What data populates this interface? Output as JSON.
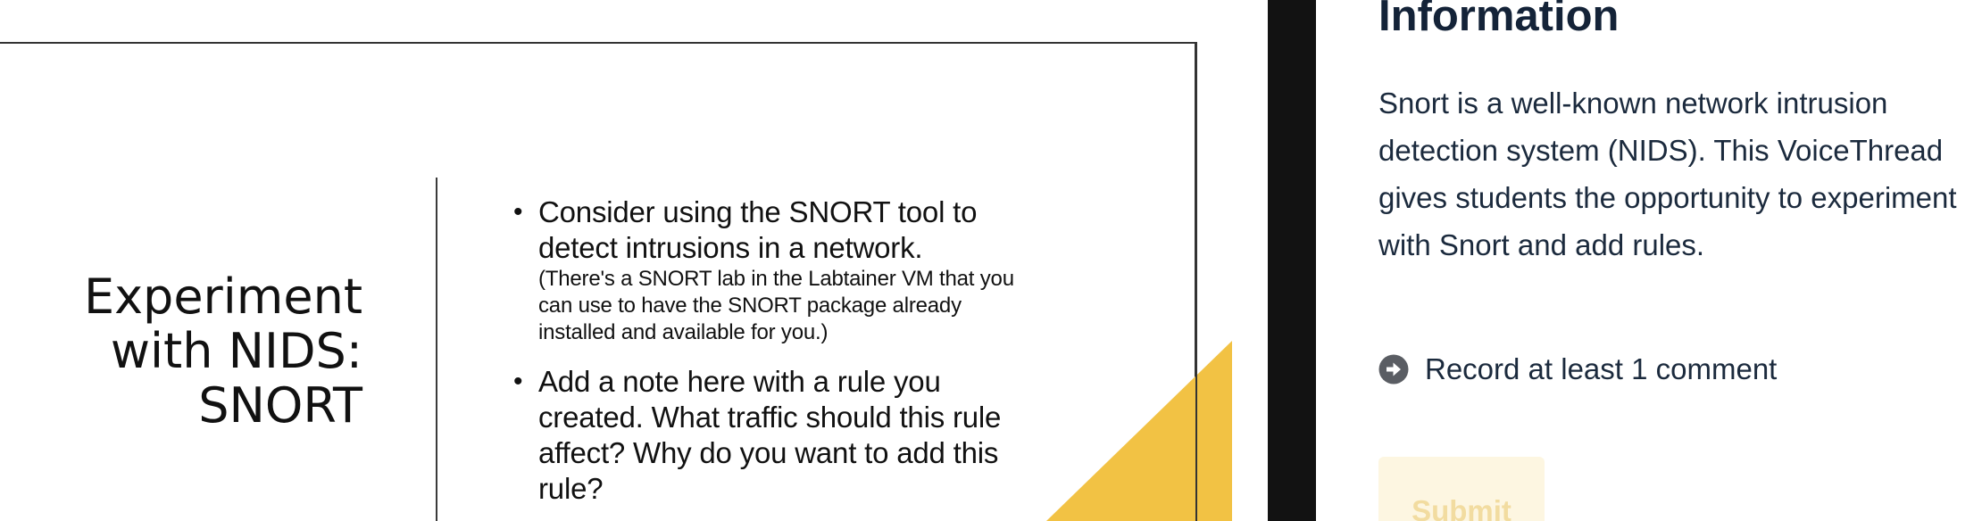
{
  "slide": {
    "title": "Experiment \nwith NIDS: \nSNORT",
    "bullets": [
      {
        "main": "Consider using the SNORT tool to detect intrusions in a network.",
        "sub": "(There's a SNORT lab in the Labtainer VM that you can use to have the SNORT package already installed and available for you.)"
      },
      {
        "main": "Add a note here with a rule you created. What traffic should this rule affect? Why do you want to add this rule?",
        "sub": ""
      }
    ],
    "bullet_symbol": "•",
    "accent_color": "#f2c244"
  },
  "panel": {
    "heading": "Information",
    "description": "Snort is a well-known network intrusion detection system (NIDS). This VoiceThread gives students the opportunity to experiment with Snort and add rules.",
    "requirement": {
      "icon": "arrow-right-circle-icon",
      "text": "Record at least 1 comment"
    },
    "submit_label": "Submit",
    "submit_state": "disabled"
  }
}
